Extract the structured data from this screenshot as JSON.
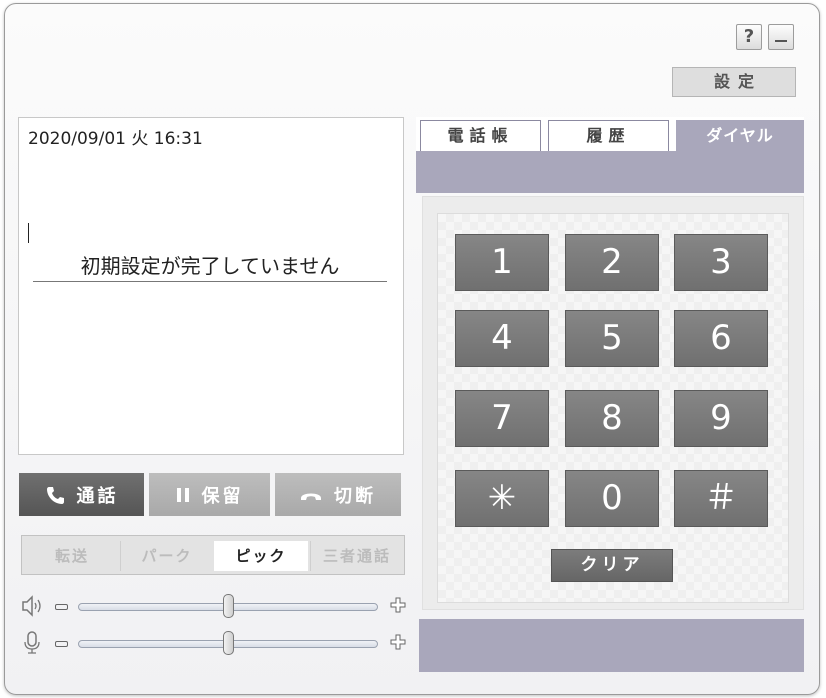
{
  "window": {
    "help_label": "?",
    "minimize_label": "_",
    "settings_label": "設定"
  },
  "display": {
    "datetime": "2020/09/01 火 16:31",
    "message": "初期設定が完了していません"
  },
  "call_buttons": {
    "talk": "通話",
    "hold": "保留",
    "hangup": "切断"
  },
  "modes": {
    "transfer": "転送",
    "park": "パーク",
    "pick": "ピック",
    "three_way": "三者通話",
    "selected": "ピック"
  },
  "volume": {
    "speaker_level": 0.5,
    "mic_level": 0.5
  },
  "tabs": {
    "phonebook": "電話帳",
    "history": "履歴",
    "dial": "ダイヤル",
    "active": "ダイヤル"
  },
  "keypad": {
    "keys": [
      "1",
      "2",
      "3",
      "4",
      "5",
      "6",
      "7",
      "8",
      "9",
      "✳",
      "0",
      "＃"
    ],
    "clear_label": "クリア"
  },
  "icons": {
    "phone": "phone-icon",
    "pause": "pause-icon",
    "hangup": "hangup-icon",
    "speaker": "speaker-icon",
    "mic": "microphone-icon",
    "minus": "minus-icon",
    "plus": "plus-icon"
  },
  "colors": {
    "tab_accent": "#a9a7bb",
    "key_bg": "#7a7a7a",
    "active_button": "#606060",
    "inactive_button": "#b3b3b3"
  }
}
